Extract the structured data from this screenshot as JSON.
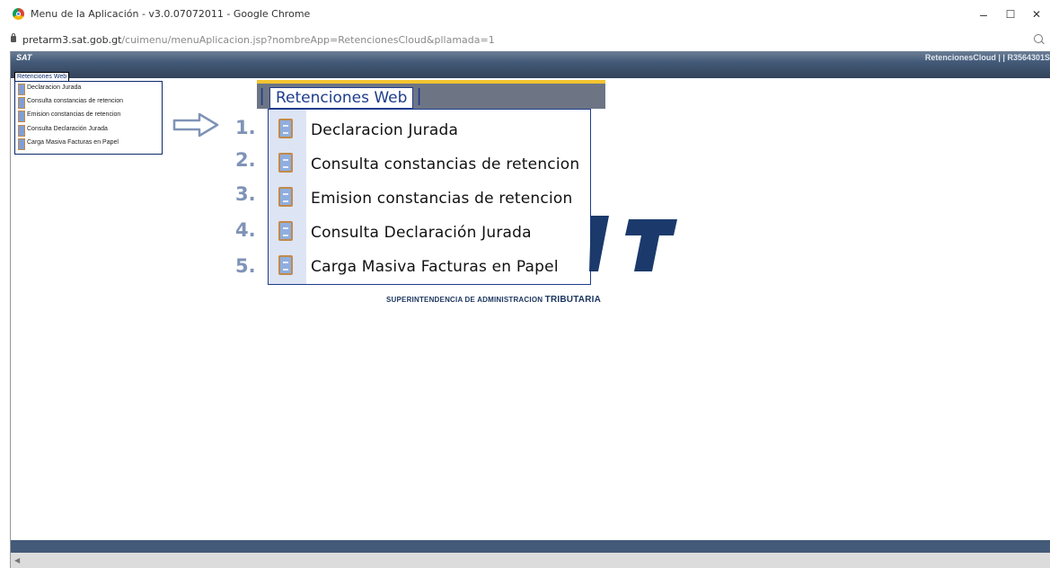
{
  "window": {
    "title": "Menu de la Aplicación - v3.0.07072011 - Google Chrome",
    "minimize": "–",
    "maximize": "☐",
    "close": "✕"
  },
  "address": {
    "domain": "pretarm3.sat.gob.gt",
    "path": "/cuimenu/menuAplicacion.jsp?nombreApp=RetencionesCloud&pllamada=1"
  },
  "appbar": {
    "logo": "SAT",
    "user": "RetencionesCloud | | R3564301S"
  },
  "small_menu": {
    "tab": "Retenciones Web",
    "items": [
      "Declaracion Jurada",
      "Consulta constancias de retencion",
      "Emision constancias de retencion",
      "Consulta Declaración Jurada",
      "Carga Masiva Facturas en Papel"
    ]
  },
  "big_menu": {
    "tab": "Retenciones Web",
    "items": [
      {
        "num": "1.",
        "label": "Declaracion Jurada"
      },
      {
        "num": "2.",
        "label": "Consulta constancias de retencion"
      },
      {
        "num": "3.",
        "label": "Emision constancias de retencion"
      },
      {
        "num": "4.",
        "label": "Consulta Declaración Jurada"
      },
      {
        "num": "5.",
        "label": "Carga Masiva Facturas en Papel"
      }
    ]
  },
  "background_logo": {
    "tagline_prefix": "SUPERINTENDENCIA DE ADMINISTRACION",
    "tagline_suffix": "TRIBUTARIA"
  },
  "colors": {
    "header": "#435a78",
    "menu_border": "#1e3c8c",
    "accent_line": "#f4c430",
    "number": "#7f93b7"
  }
}
